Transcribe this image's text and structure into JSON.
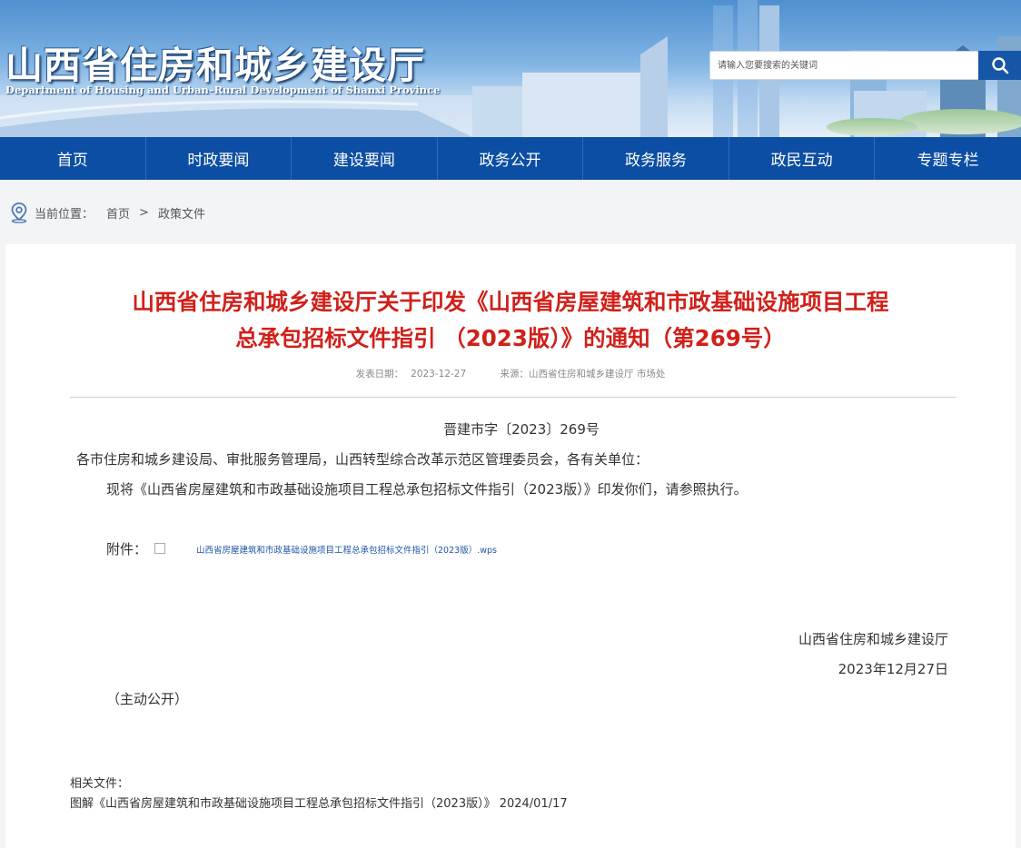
{
  "header": {
    "title": "山西省住房和城乡建设厅",
    "subtitle": "Department of Housing and Urban–Rural Development of Shanxi Province",
    "search_placeholder": "请输入您要搜索的关键词",
    "search_icon": "magnifier-icon"
  },
  "nav": {
    "items": [
      "首页",
      "时政要闻",
      "建设要闻",
      "政务公开",
      "政务服务",
      "政民互动",
      "专题专栏"
    ]
  },
  "breadcrumb": {
    "icon": "location-pin-icon",
    "label": "当前位置：",
    "items": [
      "首页",
      "政策文件"
    ],
    "separator": ">"
  },
  "article": {
    "title_line1": "山西省住房和城乡建设厅关于印发《山西省房屋建筑和市政基础设施项目工程",
    "title_line2": "总承包招标文件指引 （2023版）》的通知（第269号）",
    "date_label": "发表日期：",
    "date": "2023-12-27",
    "source_label": "来源：",
    "source": "山西省住房和城乡建设厅 市场处",
    "doc_number": "晋建市字〔2023〕269号",
    "salutation": "各市住房和城乡建设局、审批服务管理局，山西转型综合改革示范区管理委员会，各有关单位：",
    "body": "现将《山西省房屋建筑和市政基础设施项目工程总承包招标文件指引（2023版）》印发你们，请参照执行。",
    "attachment_label": "附件：",
    "attachment_link": "山西省房屋建筑和市政基础设施项目工程总承包招标文件指引（2023版）.wps",
    "sign_org": "山西省住房和城乡建设厅",
    "sign_date": "2023年12月27日",
    "disclosure": "（主动公开）",
    "related_label": "相关文件：",
    "related_item": "图解《山西省房屋建筑和市政基础设施项目工程总承包招标文件指引（2023版）》 2024/01/17"
  }
}
